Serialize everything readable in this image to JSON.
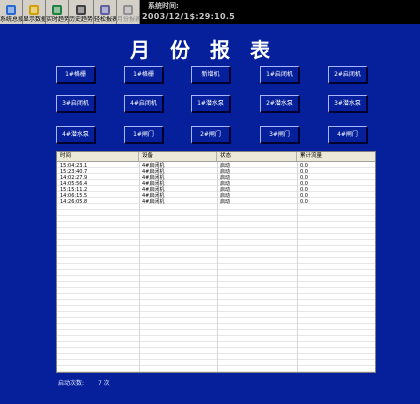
{
  "toolbar": {
    "buttons": [
      {
        "label": "系统总揽",
        "icon": "overview-icon",
        "disabled": false
      },
      {
        "label": "显示数据",
        "icon": "display-data-icon",
        "disabled": false
      },
      {
        "label": "实时趋势",
        "icon": "realtime-trend-icon",
        "disabled": false
      },
      {
        "label": "历史趋势",
        "icon": "history-trend-icon",
        "disabled": false
      },
      {
        "label": "轻松报表",
        "icon": "report-icon",
        "disabled": false
      },
      {
        "label": "月份报表",
        "icon": "monthly-report-icon",
        "disabled": true
      }
    ]
  },
  "system_time": {
    "label": "系统时间:",
    "value": "2003/12/1$:29:10.5"
  },
  "page_title": "月份报表",
  "device_buttons": [
    "1#格栅",
    "1#格栅",
    "新增机",
    "1#启闭机",
    "2#启闭机",
    "3#启闭机",
    "4#启闭机",
    "1#潜水泵",
    "2#潜水泵",
    "3#潜水泵",
    "4#潜水泵",
    "1#闸门",
    "2#闸门",
    "3#闸门",
    "4#闸门"
  ],
  "table": {
    "columns": [
      "时间",
      "设备",
      "状态",
      "累计流量"
    ],
    "rows": [
      [
        "15:04:23.1",
        "4#启闭机",
        "启动",
        "0.0"
      ],
      [
        "15:23:40.7",
        "4#启闭机",
        "启动",
        "0.0"
      ],
      [
        "14:02:27.9",
        "4#启闭机",
        "启动",
        "0.0"
      ],
      [
        "14:05:56.4",
        "4#启闭机",
        "启动",
        "0.0"
      ],
      [
        "15:15:11.2",
        "4#启闭机",
        "启动",
        "0.0"
      ],
      [
        "14:06:15.5",
        "4#启闭机",
        "启动",
        "0.0"
      ],
      [
        "14:26:05.8",
        "4#启闭机",
        "启动",
        "0.0"
      ]
    ]
  },
  "footer": {
    "label": "启动次数:",
    "value": "7 次"
  },
  "colors": {
    "background": "#05209a",
    "toolbar": "#d4d0c8"
  }
}
